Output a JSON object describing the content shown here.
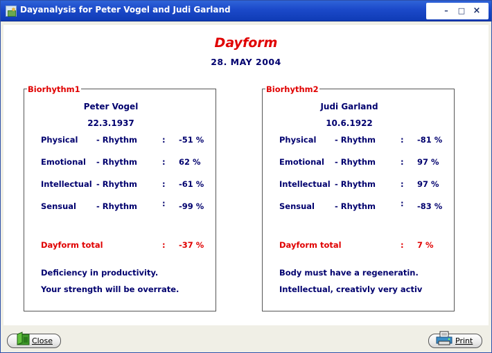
{
  "window": {
    "title": "Dayanalysis for Peter Vogel and Judi Garland"
  },
  "header": {
    "title": "Dayform",
    "date": "28. MAY  2004"
  },
  "panels": [
    {
      "legend": "Biorhythm1",
      "name": "Peter Vogel",
      "birthdate": "22.3.1937",
      "rows": [
        {
          "label": "Physical",
          "suffix": "- Rhythm",
          "colon": ":",
          "value": "-51 %"
        },
        {
          "label": "Emotional",
          "suffix": "- Rhythm",
          "colon": ":",
          "value": "62 %"
        },
        {
          "label": "Intellectual",
          "suffix": "- Rhythm",
          "colon": ":",
          "value": "-61 %"
        },
        {
          "label": "Sensual",
          "suffix": "- Rhythm",
          "colon": ":",
          "value": "-99 %"
        }
      ],
      "total": {
        "label": "Dayform total",
        "colon": ":",
        "value": "-37 %"
      },
      "messages": [
        "Deficiency in productivity.",
        "Your strength will be overrate."
      ]
    },
    {
      "legend": "Biorhythm2",
      "name": "Judi Garland",
      "birthdate": "10.6.1922",
      "rows": [
        {
          "label": "Physical",
          "suffix": "- Rhythm",
          "colon": ":",
          "value": "-81 %"
        },
        {
          "label": "Emotional",
          "suffix": "- Rhythm",
          "colon": ":",
          "value": "97 %"
        },
        {
          "label": "Intellectual",
          "suffix": "- Rhythm",
          "colon": ":",
          "value": "97 %"
        },
        {
          "label": "Sensual",
          "suffix": "- Rhythm",
          "colon": ":",
          "value": "-83 %"
        }
      ],
      "total": {
        "label": "Dayform total",
        "colon": ":",
        "value": "7 %"
      },
      "messages": [
        "Body must have a regeneratin.",
        "Intellectual, creativly very activ"
      ]
    }
  ],
  "buttons": {
    "close": "Close",
    "print": "Print"
  },
  "icons": {
    "app": "calendar-app-icon",
    "close": "folder-exit-icon",
    "print": "printer-icon"
  },
  "colors": {
    "accent_red": "#e00000",
    "text_navy": "#00006e",
    "titlebar_blue": "#1b49c9"
  }
}
